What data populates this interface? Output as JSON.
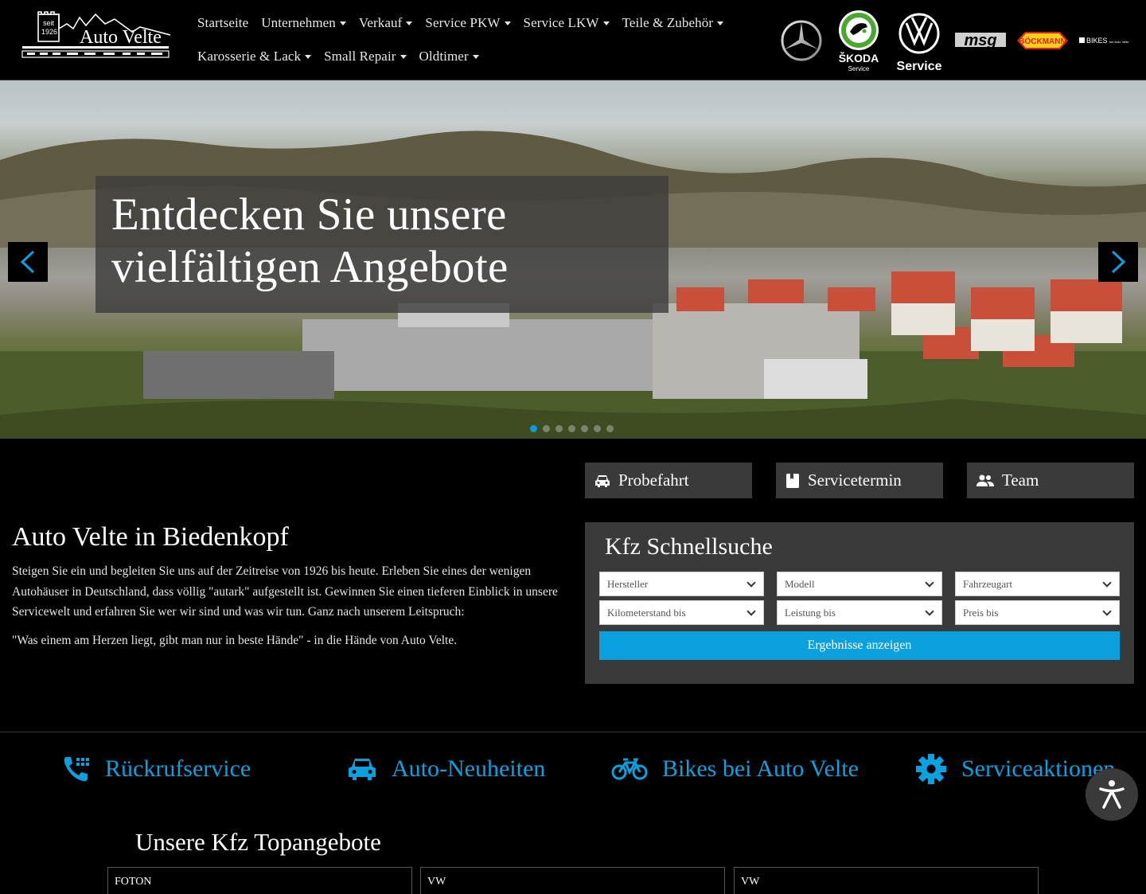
{
  "header": {
    "logo": {
      "tagline_top": "seit",
      "tagline_year": "1926",
      "name": "Auto Velte"
    },
    "nav_row1": [
      "Startseite",
      "Unternehmen",
      "Verkauf",
      "Service PKW",
      "Service LKW",
      "Teile & Zubehör"
    ],
    "nav_row1_dropdown": [
      false,
      true,
      true,
      true,
      true,
      true
    ],
    "nav_row2": [
      "Karosserie & Lack",
      "Small Repair",
      "Oldtimer"
    ],
    "brands": {
      "mercedes": "",
      "skoda_name": "ŠKODA",
      "skoda_sub": "Service",
      "vw_sub": "Service",
      "msg": "msg",
      "boeckmann": "BÖCKMANN",
      "bikes": "BIKES",
      "bikes_sub": "bei Auto Velte"
    }
  },
  "hero": {
    "caption": "Entdecken Sie unsere vielfältigen Angebote",
    "slides": 7,
    "active_slide": 0
  },
  "intro": {
    "title": "Auto Velte in Biedenkopf",
    "paragraph1": "Steigen Sie ein und begleiten Sie uns auf der Zeitreise von 1926 bis heute. Erleben Sie eines der wenigen Autohäuser in Deutschland, dass völlig \"autark\" aufgestellt ist. Gewinnen Sie einen tieferen Einblick in unsere Servicewelt und erfahren Sie wer wir sind und was wir tun. Ganz nach unserem Leitspruch:",
    "paragraph2": "\"Was einem am Herzen liegt, gibt man nur in beste Hände\" - in die Hände von Auto Velte."
  },
  "quick_buttons": {
    "probefahrt": "Probefahrt",
    "servicetermin": "Servicetermin",
    "team": "Team"
  },
  "search": {
    "title": "Kfz Schnellsuche",
    "hersteller": "Hersteller",
    "modell": "Modell",
    "fahrzeugart": "Fahrzeugart",
    "kilometerstand": "Kilometerstand bis",
    "leistung": "Leistung bis",
    "preis": "Preis bis",
    "submit": "Ergebnisse anzeigen"
  },
  "features": {
    "rueckruf": "Rückrufservice",
    "neuheiten": "Auto-Neuheiten",
    "bikes": "Bikes bei Auto Velte",
    "aktionen": "Serviceaktionen"
  },
  "offers": {
    "title": "Unsere Kfz Topangebote",
    "items": [
      "FOTON",
      "VW",
      "VW"
    ]
  },
  "colors": {
    "accent": "#0ba1df",
    "panel": "#3a3a3a",
    "background": "#000000"
  }
}
